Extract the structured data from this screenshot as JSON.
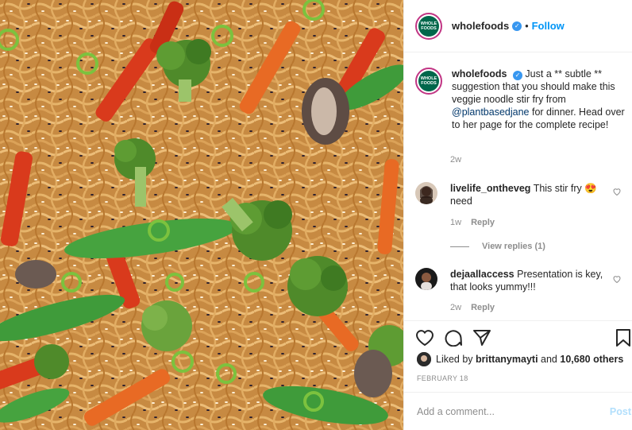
{
  "image": {
    "alt_subject": "veggie noodle stir fry photo",
    "colors": {
      "noodle": "#d49a4e",
      "broccoli": "#4f8a2a",
      "pepper": "#d93a1c",
      "carrot": "#e86a24",
      "snowpea": "#3f9b3a",
      "mushroom": "#6b5a52"
    }
  },
  "header": {
    "username": "wholefoods",
    "avatar_text": "WHOLE FOODS",
    "separator": "•",
    "follow_label": "Follow"
  },
  "caption": {
    "username": "wholefoods",
    "text_before": "Just a ** subtle ** suggestion that you should make this veggie noodle stir fry from ",
    "mention": "@plantbasedjane",
    "text_after": " for dinner. Head over to her page for the complete recipe!",
    "time": "2w"
  },
  "comments": [
    {
      "username": "livelife_ontheveg",
      "text": "This stir fry 😍 need",
      "time": "1w",
      "reply_label": "Reply"
    },
    {
      "username": "dejaallaccess",
      "text": "Presentation is key, that looks yummy!!!",
      "time": "2w",
      "reply_label": "Reply"
    }
  ],
  "view_replies_label": "View replies (1)",
  "likes": {
    "prefix": "Liked by ",
    "user": "brittanymayti",
    "middle": " and ",
    "count": "10,680 others"
  },
  "date": "FEBRUARY 18",
  "add_comment": {
    "placeholder": "Add a comment...",
    "post_label": "Post"
  },
  "colors": {
    "link": "#0095f6",
    "mention": "#00376b",
    "muted": "#8e8e8e",
    "brand": "#00674b"
  }
}
